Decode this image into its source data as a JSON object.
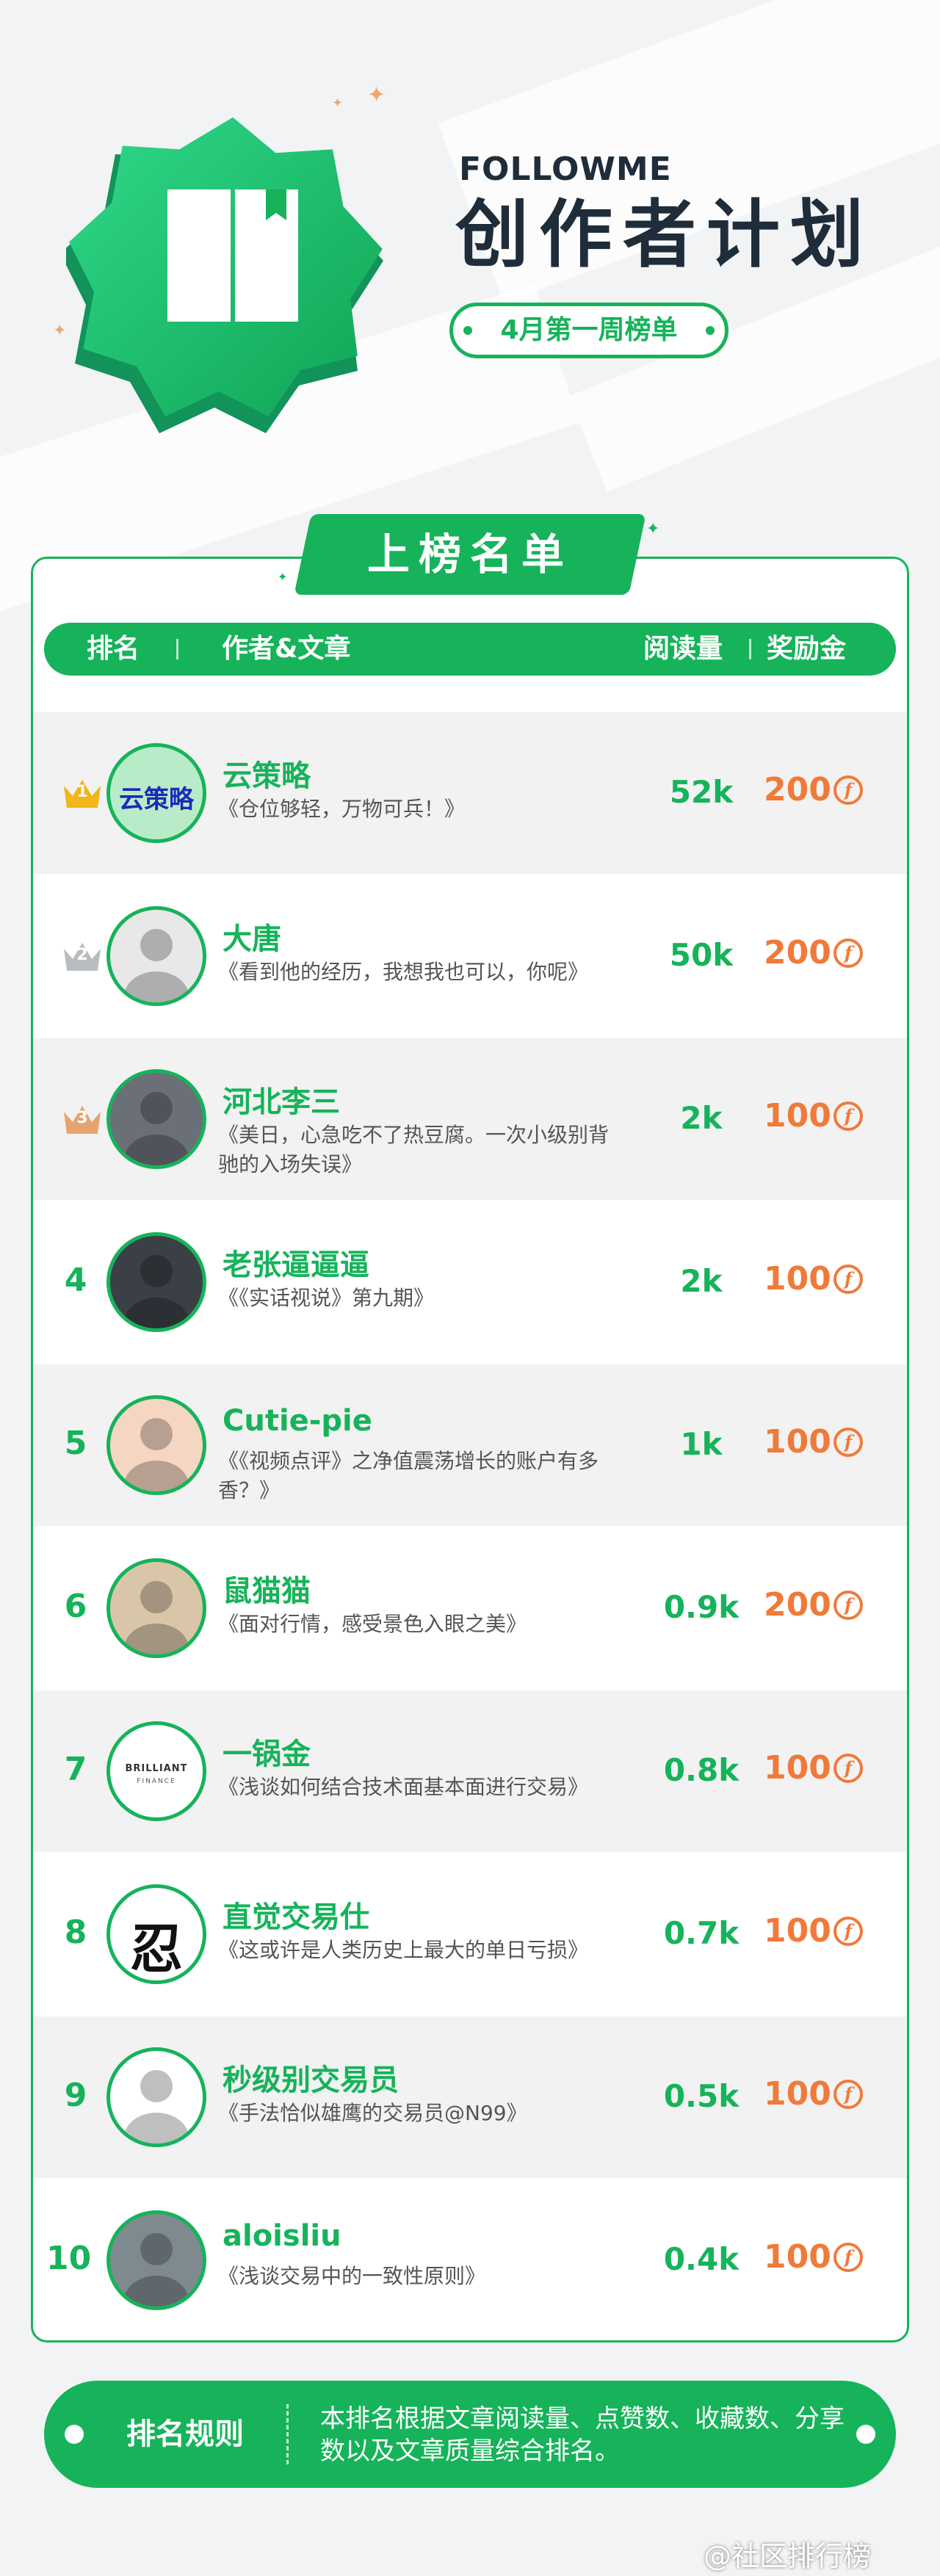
{
  "header": {
    "brand": "FOLLOWME",
    "title": "创作者计划",
    "week": "4月第一周榜单"
  },
  "list": {
    "title": "上榜名单",
    "columns": {
      "rank": "排名",
      "author_article": "作者&文章",
      "reads": "阅读量",
      "bonus": "奖励金"
    },
    "rows": [
      {
        "rank": "1",
        "author": "云策略",
        "article": "《仓位够轻，万物可兵！》",
        "reads": "52k",
        "bonus": "200",
        "avatar_text": "云策略"
      },
      {
        "rank": "2",
        "author": "大唐",
        "article": "《看到他的经历，我想我也可以，你呢》",
        "reads": "50k",
        "bonus": "200"
      },
      {
        "rank": "3",
        "author": "河北李三",
        "article": "《美日，心急吃不了热豆腐。一次小级别背驰的入场失误》",
        "reads": "2k",
        "bonus": "100"
      },
      {
        "rank": "4",
        "author": "老张逼逼逼",
        "article": "《《实话视说》第九期》",
        "reads": "2k",
        "bonus": "100"
      },
      {
        "rank": "5",
        "author": "Cutie-pie",
        "article": "《《视频点评》之净值震荡增长的账户有多香？》",
        "reads": "1k",
        "bonus": "100"
      },
      {
        "rank": "6",
        "author": "鼠猫猫",
        "article": "《面对行情，感受景色入眼之美》",
        "reads": "0.9k",
        "bonus": "200"
      },
      {
        "rank": "7",
        "author": "一锅金",
        "article": "《浅谈如何结合技术面基本面进行交易》",
        "reads": "0.8k",
        "bonus": "100",
        "avatar_text": "BRILLIANT",
        "avatar_sub": "FINANCE"
      },
      {
        "rank": "8",
        "author": "直觉交易仕",
        "article": "《这或许是人类历史上最大的单日亏损》",
        "reads": "0.7k",
        "bonus": "100",
        "avatar_text": "忍"
      },
      {
        "rank": "9",
        "author": "秒级别交易员",
        "article": "《手法恰似雄鹰的交易员@N99》",
        "reads": "0.5k",
        "bonus": "100"
      },
      {
        "rank": "10",
        "author": "aloisliu",
        "article": "《浅谈交易中的一致性原则》",
        "reads": "0.4k",
        "bonus": "100"
      }
    ]
  },
  "rules": {
    "label": "排名规则",
    "text": "本排名根据文章阅读量、点赞数、收藏数、分享数以及文章质量综合排名。"
  },
  "watermark": "@社区排行榜",
  "colors": {
    "accent": "#16b35a",
    "bonus": "#f07a3a",
    "gold": "#f2b51a",
    "silver": "#b9bcc0",
    "bronze": "#e7a46f"
  },
  "icons": {
    "badge": "book-icon",
    "coin": "coin-icon",
    "crown": "crown-icon"
  }
}
